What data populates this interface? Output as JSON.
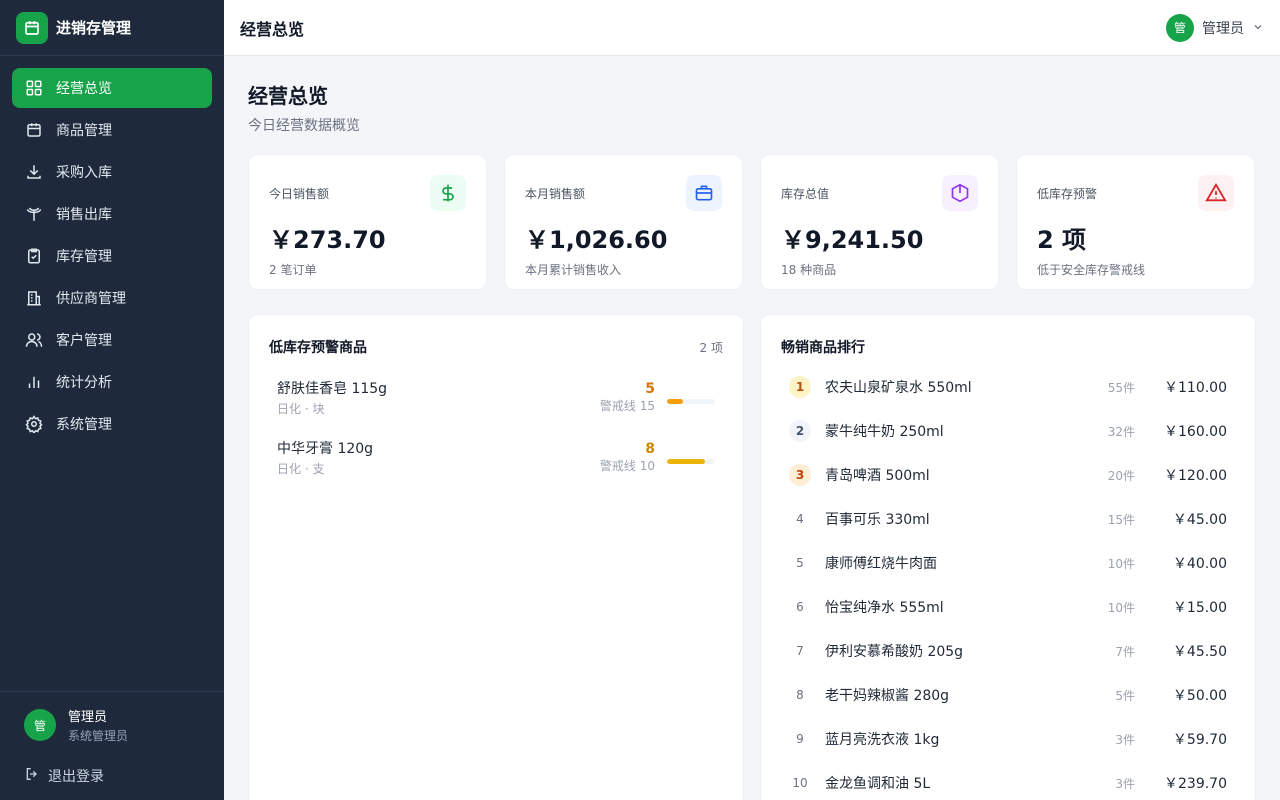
{
  "app": {
    "title": "进销存管理"
  },
  "colors": {
    "brand": "#16a34a",
    "sidebar": "#1e293b",
    "warn": "#ef4444"
  },
  "sidebar": {
    "items": [
      {
        "label": "经营总览",
        "icon": "dashboard-grid-icon",
        "active": true
      },
      {
        "label": "商品管理",
        "icon": "calendar-box-icon"
      },
      {
        "label": "采购入库",
        "icon": "download-icon"
      },
      {
        "label": "销售出库",
        "icon": "antenna-icon"
      },
      {
        "label": "库存管理",
        "icon": "clipboard-check-icon"
      },
      {
        "label": "供应商管理",
        "icon": "building-icon"
      },
      {
        "label": "客户管理",
        "icon": "users-icon"
      },
      {
        "label": "统计分析",
        "icon": "bar-chart-icon"
      },
      {
        "label": "系统管理",
        "icon": "gear-icon"
      }
    ],
    "user": {
      "avatar": "管",
      "name": "管理员",
      "role": "系统管理员"
    },
    "logout": "退出登录"
  },
  "header": {
    "title": "经营总览",
    "user": {
      "avatar": "管",
      "name": "管理员"
    }
  },
  "page": {
    "title": "经营总览",
    "subtitle": "今日经营数据概览"
  },
  "stats": [
    {
      "label": "今日销售额",
      "value": "￥273.70",
      "note": "2 笔订单",
      "icon": "dollar-icon",
      "color": "#16a34a",
      "bg": "#ecfdf3"
    },
    {
      "label": "本月销售额",
      "value": "￥1,026.60",
      "note": "本月累计销售收入",
      "icon": "briefcase-icon",
      "color": "#2563eb",
      "bg": "#eef4ff"
    },
    {
      "label": "库存总值",
      "value": "￥9,241.50",
      "note": "18 种商品",
      "icon": "hexagon-icon",
      "color": "#9333ea",
      "bg": "#f6f0ff"
    },
    {
      "label": "低库存预警",
      "value": "2 项",
      "note": "低于安全库存警戒线",
      "icon": "warning-triangle-icon",
      "color": "#dc2626",
      "bg": "#fef1f1"
    }
  ],
  "low_stock": {
    "title": "低库存预警商品",
    "count": "2 项",
    "items": [
      {
        "name": "舒肤佳香皂 115g",
        "category": "日化 · 块",
        "qty": "5",
        "threshold": "警戒线 15",
        "level": 0.33,
        "color": "#d97706",
        "bar": "#f59e0b"
      },
      {
        "name": "中华牙膏 120g",
        "category": "日化 · 支",
        "qty": "8",
        "threshold": "警戒线 10",
        "level": 0.8,
        "color": "#ca8a04",
        "bar": "#eab308"
      }
    ]
  },
  "top_products": {
    "title": "畅销商品排行",
    "rows": [
      {
        "rank": "1",
        "name": "农夫山泉矿泉水 550ml",
        "qty": "55件",
        "amount": "￥110.00",
        "badge_bg": "#fef3c7",
        "badge_fg": "#b45309"
      },
      {
        "rank": "2",
        "name": "蒙牛纯牛奶 250ml",
        "qty": "32件",
        "amount": "￥160.00",
        "badge_bg": "#f1f5f9",
        "badge_fg": "#475569"
      },
      {
        "rank": "3",
        "name": "青岛啤酒 500ml",
        "qty": "20件",
        "amount": "￥120.00",
        "badge_bg": "#ffedd5",
        "badge_fg": "#c2410c"
      },
      {
        "rank": "4",
        "name": "百事可乐 330ml",
        "qty": "15件",
        "amount": "￥45.00"
      },
      {
        "rank": "5",
        "name": "康师傅红烧牛肉面",
        "qty": "10件",
        "amount": "￥40.00"
      },
      {
        "rank": "6",
        "name": "怡宝纯净水 555ml",
        "qty": "10件",
        "amount": "￥15.00"
      },
      {
        "rank": "7",
        "name": "伊利安慕希酸奶 205g",
        "qty": "7件",
        "amount": "￥45.50"
      },
      {
        "rank": "8",
        "name": "老干妈辣椒酱 280g",
        "qty": "5件",
        "amount": "￥50.00"
      },
      {
        "rank": "9",
        "name": "蓝月亮洗衣液 1kg",
        "qty": "3件",
        "amount": "￥59.70"
      },
      {
        "rank": "10",
        "name": "金龙鱼调和油 5L",
        "qty": "3件",
        "amount": "￥239.70"
      }
    ]
  }
}
